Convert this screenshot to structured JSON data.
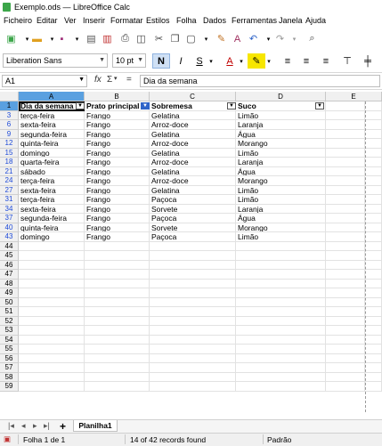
{
  "window": {
    "title": "Exemplo.ods — LibreOffice Calc"
  },
  "menu": [
    "Ficheiro",
    "Editar",
    "Ver",
    "Inserir",
    "Formatar",
    "Estilos",
    "Folha",
    "Dados",
    "Ferramentas",
    "Janela",
    "Ajuda"
  ],
  "toolbar": {
    "font_name": "Liberation Sans",
    "font_size": "10 pt"
  },
  "formula_bar": {
    "cell_ref": "A1",
    "fx": "fx",
    "sigma": "Σ",
    "equals": "=",
    "content": "Dia da semana"
  },
  "columns": [
    "A",
    "B",
    "C",
    "D",
    "E"
  ],
  "table": {
    "headers": [
      "Dia da semana",
      "Prato principal",
      "Sobremesa",
      "Suco"
    ],
    "rows": [
      {
        "n": "1",
        "hdr": true
      },
      {
        "n": "3",
        "cells": [
          "terça-feira",
          "Frango",
          "Gelatina",
          "Limão"
        ]
      },
      {
        "n": "6",
        "cells": [
          "sexta-feira",
          "Frango",
          "Arroz-doce",
          "Laranja"
        ]
      },
      {
        "n": "9",
        "cells": [
          "segunda-feira",
          "Frango",
          "Gelatina",
          "Água"
        ]
      },
      {
        "n": "12",
        "cells": [
          "quinta-feira",
          "Frango",
          "Arroz-doce",
          "Morango"
        ]
      },
      {
        "n": "15",
        "cells": [
          "domingo",
          "Frango",
          "Gelatina",
          "Limão"
        ]
      },
      {
        "n": "18",
        "cells": [
          "quarta-feira",
          "Frango",
          "Arroz-doce",
          "Laranja"
        ]
      },
      {
        "n": "21",
        "cells": [
          "sábado",
          "Frango",
          "Gelatina",
          "Água"
        ]
      },
      {
        "n": "24",
        "cells": [
          "terça-feira",
          "Frango",
          "Arroz-doce",
          "Morango"
        ]
      },
      {
        "n": "27",
        "cells": [
          "sexta-feira",
          "Frango",
          "Gelatina",
          "Limão"
        ]
      },
      {
        "n": "31",
        "cells": [
          "terça-feira",
          "Frango",
          "Paçoca",
          "Limão"
        ]
      },
      {
        "n": "34",
        "cells": [
          "sexta-feira",
          "Frango",
          "Sorvete",
          "Laranja"
        ]
      },
      {
        "n": "37",
        "cells": [
          "segunda-feira",
          "Frango",
          "Paçoca",
          "Água"
        ]
      },
      {
        "n": "40",
        "cells": [
          "quinta-feira",
          "Frango",
          "Sorvete",
          "Morango"
        ]
      },
      {
        "n": "43",
        "cells": [
          "domingo",
          "Frango",
          "Paçoca",
          "Limão"
        ]
      },
      {
        "n": "44"
      },
      {
        "n": "45"
      },
      {
        "n": "46"
      },
      {
        "n": "47"
      },
      {
        "n": "48"
      },
      {
        "n": "49"
      },
      {
        "n": "50"
      },
      {
        "n": "51"
      },
      {
        "n": "52"
      },
      {
        "n": "53"
      },
      {
        "n": "54"
      },
      {
        "n": "55"
      },
      {
        "n": "56"
      },
      {
        "n": "57"
      },
      {
        "n": "58"
      },
      {
        "n": "59"
      }
    ]
  },
  "sheet_tab": "Planilha1",
  "status": {
    "sheet": "Folha 1 de 1",
    "records": "14 of 42 records found",
    "style": "Padrão"
  },
  "colors": {
    "selection": "#5aa0e0",
    "filtered_row_number": "#1f4bd8",
    "brand_green": "#3ca64a"
  }
}
